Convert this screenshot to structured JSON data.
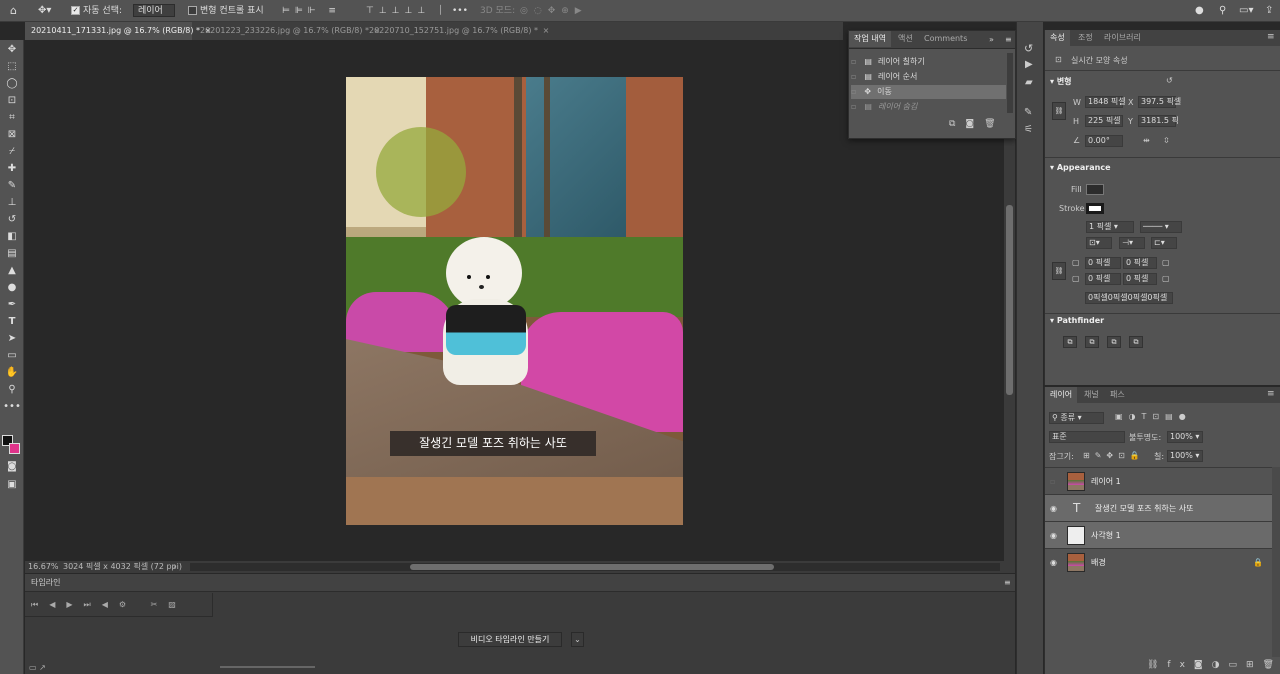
{
  "options_bar": {
    "auto_select_label": "자동 선택:",
    "auto_select_value": "레이어",
    "transform_controls_label": "변형 컨트롤 표시",
    "mode_3d_label": "3D 모드:",
    "more_label": "•••"
  },
  "doc_tabs": [
    {
      "label": "20210411_171331.jpg @ 16.7% (RGB/8) *"
    },
    {
      "label": "20201223_233226.jpg @ 16.7% (RGB/8) *"
    },
    {
      "label": "20220710_152751.jpg @ 16.7% (RGB/8) *"
    }
  ],
  "canvas": {
    "caption": "잘생긴 모델 포즈 취하는 사또"
  },
  "status_bar": {
    "zoom": "16.67%",
    "doc_info": "3024 픽셀 x 4032 픽셀 (72 ppi)"
  },
  "history_panel": {
    "tabs": [
      "작업 내역",
      "액션",
      "Comments"
    ],
    "items": [
      {
        "label": "레이어 칠하기"
      },
      {
        "label": "레이어 순서"
      },
      {
        "label": "이동"
      },
      {
        "label": "레이어 숨김"
      }
    ]
  },
  "timeline": {
    "title": "타임라인",
    "create_button": "비디오 타임라인 만들기"
  },
  "properties": {
    "tabs": [
      "속성",
      "조정",
      "라이브러리"
    ],
    "live_shape_label": "실시간 모양 속성",
    "transform_title": "변형",
    "w_label": "W",
    "w_value": "1848 픽셀",
    "x_label": "X",
    "x_value": "397.5 픽셀",
    "h_label": "H",
    "h_value": "225 픽셀",
    "y_label": "Y",
    "y_value": "3181.5 픽",
    "angle_value": "0.00°",
    "appearance_title": "Appearance",
    "fill_label": "Fill",
    "stroke_label": "Stroke",
    "stroke_width": "1 픽셀",
    "corner_tl": "0 픽셀",
    "corner_tr": "0 픽셀",
    "corner_bl": "0 픽셀",
    "corner_br": "0 픽셀",
    "corner_all": "0픽셀0픽셀0픽셀0픽셀",
    "pathfinder_title": "Pathfinder"
  },
  "layers": {
    "tabs": [
      "레이어",
      "채널",
      "패스"
    ],
    "filter_kind": "종류",
    "blend_mode": "표준",
    "opacity_label": "불투명도:",
    "opacity_value": "100%",
    "lock_label": "잠그기:",
    "fill_label": "칠:",
    "fill_value": "100%",
    "items": [
      {
        "name": "레이어 1"
      },
      {
        "name": "잘생긴 모델 포즈 취하는 사또"
      },
      {
        "name": "사각형 1"
      },
      {
        "name": "배경"
      }
    ]
  }
}
